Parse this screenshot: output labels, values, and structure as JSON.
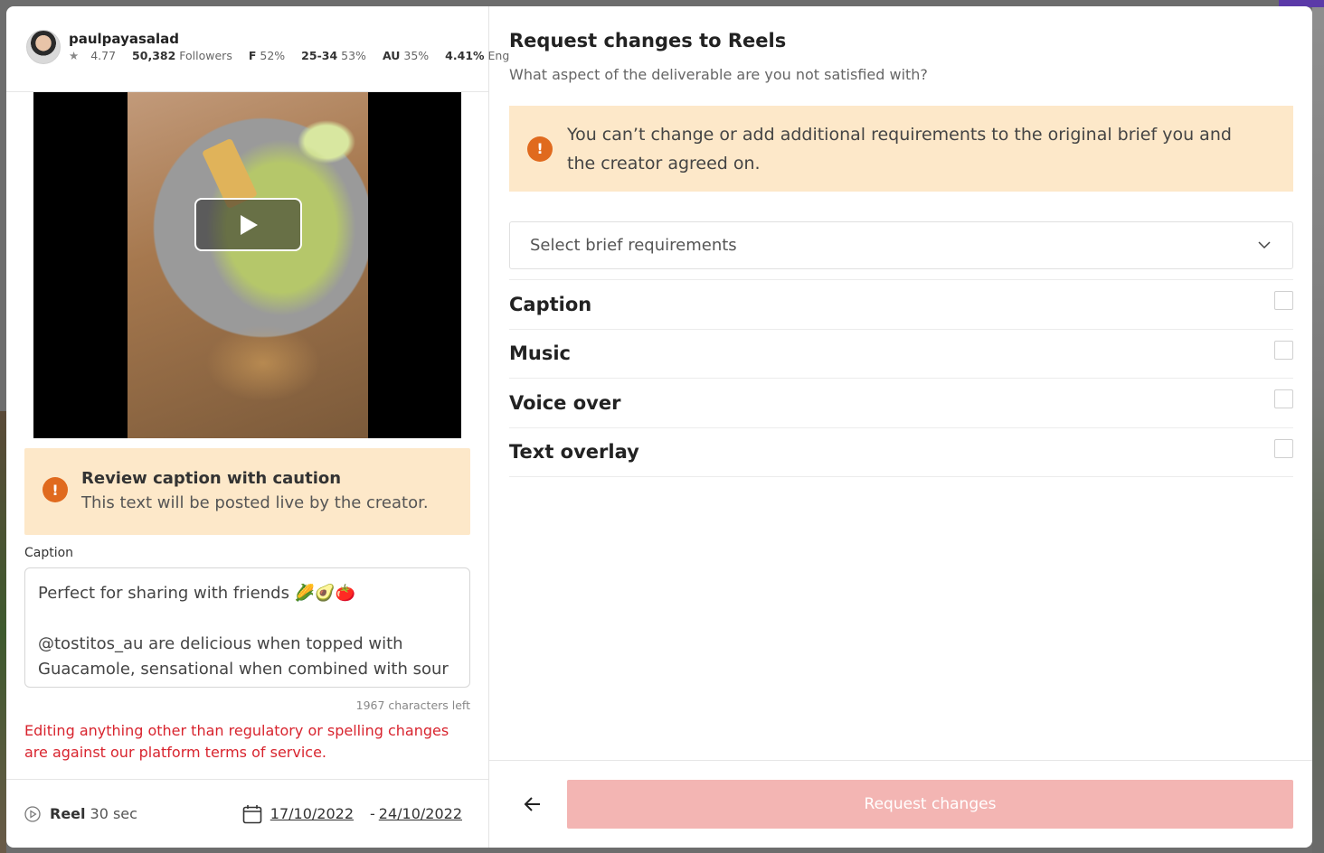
{
  "creator": {
    "username": "paulpayasalad",
    "rating": "4.77",
    "followers_count": "50,382",
    "followers_label": "Followers",
    "female_label": "F",
    "female_pct": "52%",
    "age_range": "25-34",
    "age_pct": "53%",
    "country": "AU",
    "country_pct": "35%",
    "engagement": "4.41%",
    "engagement_label": "Eng"
  },
  "caution": {
    "title": "Review caption with caution",
    "body": "This text will be posted live by the creator."
  },
  "caption": {
    "label": "Caption",
    "text": "Perfect for sharing with friends 🌽🥑🍅\n\n@tostitos_au are delicious when topped with Guacamole, sensational when combined with sour",
    "chars_left": "1967 characters left",
    "tos_warning": "Editing anything other than regulatory or spelling changes are against our platform terms of service."
  },
  "deliverable": {
    "type": "Reel",
    "duration": "30 sec",
    "start_date": "17/10/2022",
    "end_date": "24/10/2022",
    "date_separator": "-"
  },
  "request": {
    "title": "Request changes to Reels",
    "subtitle": "What aspect of the deliverable are you not satisfied with?",
    "alert": "You can’t change or add additional requirements to the original brief you and the creator agreed on.",
    "select_placeholder": "Select brief requirements",
    "requirements": [
      {
        "label": "Caption",
        "checked": false
      },
      {
        "label": "Music",
        "checked": false
      },
      {
        "label": "Voice over",
        "checked": false
      },
      {
        "label": "Text overlay",
        "checked": false
      }
    ],
    "submit_label": "Request changes"
  },
  "colors": {
    "warning_bg": "#fde8c9",
    "warning_icon": "#e06a1e",
    "error_text": "#d8242e",
    "submit_disabled": "#f3b5b3"
  }
}
